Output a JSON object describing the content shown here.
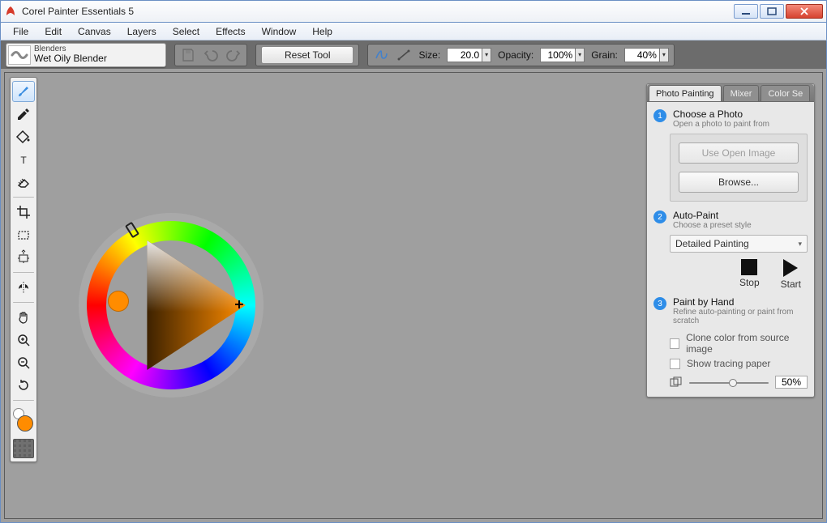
{
  "title": "Corel Painter Essentials 5",
  "menus": [
    "File",
    "Edit",
    "Canvas",
    "Layers",
    "Select",
    "Effects",
    "Window",
    "Help"
  ],
  "brush": {
    "category": "Blenders",
    "name": "Wet Oily Blender"
  },
  "toolbar": {
    "reset_label": "Reset Tool",
    "size_label": "Size:",
    "size_value": "20.0",
    "opacity_label": "Opacity:",
    "opacity_value": "100%",
    "grain_label": "Grain:",
    "grain_value": "40%"
  },
  "colors": {
    "foreground": "#ff8c00",
    "background": "#ffffff"
  },
  "panel": {
    "tabs": [
      "Photo Painting",
      "Mixer",
      "Color Se"
    ],
    "active_tab": "Photo Painting",
    "steps": {
      "s1": {
        "title": "Choose a Photo",
        "sub": "Open a photo to paint from"
      },
      "s2": {
        "title": "Auto-Paint",
        "sub": "Choose a preset style"
      },
      "s3": {
        "title": "Paint by Hand",
        "sub": "Refine auto-painting or paint from scratch"
      }
    },
    "use_open_image": "Use Open Image",
    "browse": "Browse...",
    "preset": "Detailed Painting",
    "stop": "Stop",
    "start": "Start",
    "clone_label": "Clone color from source image",
    "tracing_label": "Show tracing paper",
    "tracing_value": "50%"
  }
}
